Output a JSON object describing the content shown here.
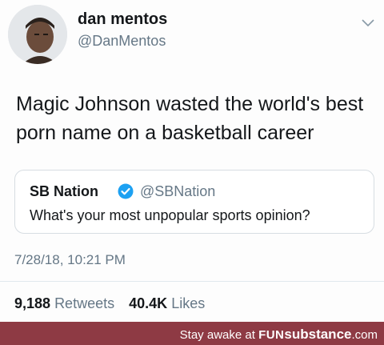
{
  "tweet": {
    "author": {
      "display_name": "dan mentos",
      "handle": "@DanMentos",
      "avatar_icon": "profile-photo"
    },
    "text": "Magic Johnson wasted the world's best porn name on a basketball career",
    "quoted_tweet": {
      "display_name": "SB Nation",
      "verified_icon": "verified-badge-icon",
      "handle": "@SBNation",
      "text": "What's your most unpopular sports opinion?"
    },
    "timestamp": "7/28/18, 10:21 PM",
    "stats": {
      "retweets_count": "9,188",
      "retweets_label": "Retweets",
      "likes_count": "40.4K",
      "likes_label": "Likes"
    }
  },
  "watermark": {
    "prefix": "Stay awake at ",
    "brand_part1": "FUN",
    "brand_part2": "substance",
    "suffix": ".com",
    "background_color": "#8e3a44"
  },
  "colors": {
    "text_primary": "#14171a",
    "text_secondary": "#657786",
    "verified_blue": "#1da1f2"
  }
}
